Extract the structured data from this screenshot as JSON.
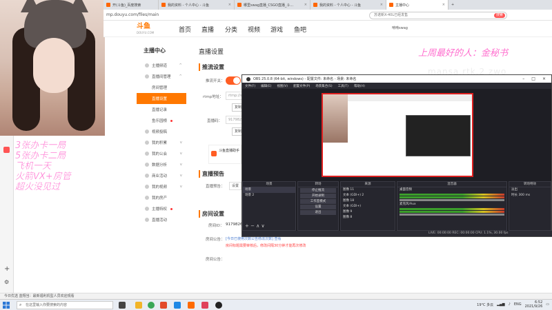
{
  "browser": {
    "tabs": [
      {
        "label": "开(斗鱼)_百度搜索"
      },
      {
        "label": "我的资料 - 个人中心 - 斗鱼"
      },
      {
        "label": "哪里swag直播_CSGO直播_斗..."
      },
      {
        "label": "我的资料 - 个人中心 - 斗鱼"
      },
      {
        "label": "主播中心",
        "active": true
      }
    ],
    "url": "mp.douyu.com/files/main",
    "search_placeholder": "苏诺新X-40L已经发售",
    "search_button": "搜索"
  },
  "douyu_nav": {
    "logo_text": "斗鱼",
    "logo_sub": "DOUYU.COM",
    "items": [
      "首页",
      "直播",
      "分类",
      "视频",
      "游戏",
      "鱼吧"
    ],
    "search_placeholder": "搜索",
    "user": "啃啃swag"
  },
  "sidebar": {
    "heading": "主播中心",
    "items": [
      {
        "label": "主播频道"
      },
      {
        "label": "直播间管理"
      },
      {
        "label": "房间管理",
        "sub": true
      },
      {
        "label": "直播设置",
        "sub": true,
        "active": true
      },
      {
        "label": "直播记录",
        "sub": true
      },
      {
        "label": "鱼乐园榜",
        "sub": true
      },
      {
        "label": "视频投稿"
      },
      {
        "label": "我的积累"
      },
      {
        "label": "我的公会"
      },
      {
        "label": "数据分析"
      },
      {
        "label": "商业活动"
      },
      {
        "label": "我的视频"
      },
      {
        "label": "我的房产"
      },
      {
        "label": "主播特权"
      },
      {
        "label": "直播活动"
      }
    ]
  },
  "main": {
    "title": "直播设置",
    "sec_stream": "推流设置",
    "label_push": "推流开关：",
    "label_rtmp": "rtmp地址：",
    "rtmp_value": "rtmp://sendtc3...",
    "copy_btn": "复制",
    "label_code": "直播码：",
    "code_value": "9179826...",
    "promo": "斗鱼直播助手",
    "sec_preview": "直播预告",
    "label_preview": "直播预告：",
    "preview_btn": "设置",
    "sec_room": "房间设置",
    "label_roomid": "房间ID：",
    "roomid_value": "9179826",
    "label_announce": "房间公告：",
    "note1": "[今日已使用次数公告修改次数] 查看",
    "note2": "房间标题需要审核后，修改间隔30分钟才能再次修改",
    "label_cover": "房间公告："
  },
  "overlay": {
    "top_right": "上周最好的人：金秘书",
    "top_right_2": "mansa.rtk.2 zwo",
    "left_lines": [
      "3张办卡一局",
      "5张办卡二局",
      "飞机一天",
      "火箭VX+房管",
      "超火没见过"
    ]
  },
  "obs": {
    "title": "OBS 25.0.8 (64-bit, windows) - 配置文件: 未命名 - 场景: 未命名",
    "menu": [
      "文件(F)",
      "编辑(E)",
      "视图(V)",
      "配置文件(P)",
      "场景集合(S)",
      "工具(T)",
      "帮助(H)"
    ],
    "docks": {
      "scenes": {
        "title": "场景",
        "items": [
          "场景",
          "场景 2"
        ]
      },
      "transitions": {
        "title": "转场",
        "buttons": [
          "停止推流",
          "开始录制",
          "工作室模式",
          "设置",
          "退出"
        ]
      },
      "sources": {
        "title": "来源",
        "items": [
          "图像 11",
          "文本 (GDI+) 2",
          "图像 18",
          "文本 (GDI+)",
          "图像 9",
          "图像 8"
        ]
      },
      "mixer": {
        "title": "混音器",
        "channels": [
          "桌面音频",
          "麦克风/Aux"
        ]
      },
      "controls": {
        "title": "转场特效",
        "fade": "淡出",
        "duration_label": "时长",
        "duration": "300 ms"
      }
    },
    "status": "LIVE: 00:00:00  REC: 00:00:00  CPU: 1.1%, 30.00 fps"
  },
  "bottom": {
    "browser_status": "今日优选  蓝翔当：最新福利机型人员欢迎观看"
  },
  "taskbar": {
    "search_placeholder": "在这里输入你要搜索的内容",
    "weather": "19°C 多云",
    "lang": "ENG",
    "time": "6:52",
    "date": "2021/9/26"
  }
}
